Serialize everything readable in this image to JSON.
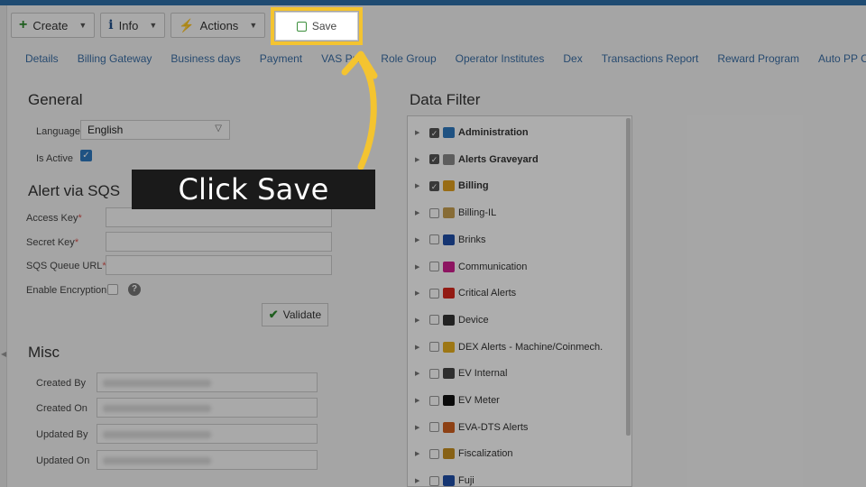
{
  "toolbar": {
    "create_label": "Create",
    "info_label": "Info",
    "actions_label": "Actions",
    "save_label": "Save"
  },
  "tabs": [
    "Details",
    "Billing Gateway",
    "Business days",
    "Payment",
    "VAS Pro",
    "Role Group",
    "Operator Institutes",
    "Dex",
    "Transactions Report",
    "Reward Program",
    "Auto PP C"
  ],
  "general": {
    "title": "General",
    "language_label": "Language",
    "language_value": "English",
    "is_active_label": "Is Active"
  },
  "sqs": {
    "title": "Alert via SQS",
    "access_key_label": "Access Key",
    "secret_key_label": "Secret Key",
    "queue_url_label": "SQS Queue URL",
    "encryption_label": "Enable Encryption",
    "required_mark": "*",
    "validate_label": "Validate"
  },
  "misc": {
    "title": "Misc",
    "created_by_label": "Created By",
    "created_on_label": "Created On",
    "updated_by_label": "Updated By",
    "updated_on_label": "Updated On"
  },
  "data_filter": {
    "title": "Data Filter",
    "items": [
      {
        "label": "Administration",
        "checked": true,
        "bold": true,
        "icon": "key-icon",
        "color": "#2f7ac0"
      },
      {
        "label": "Alerts Graveyard",
        "checked": true,
        "bold": true,
        "icon": "gravestone-icon",
        "color": "#8a8a8a"
      },
      {
        "label": "Billing",
        "checked": true,
        "bold": true,
        "icon": "billing-icon",
        "color": "#e0a020"
      },
      {
        "label": "Billing-IL",
        "checked": false,
        "bold": false,
        "icon": "billing-il-icon",
        "color": "#c8a050"
      },
      {
        "label": "Brinks",
        "checked": false,
        "bold": false,
        "icon": "brinks-icon",
        "color": "#1f4ea8"
      },
      {
        "label": "Communication",
        "checked": false,
        "bold": false,
        "icon": "signal-icon",
        "color": "#d02090"
      },
      {
        "label": "Critical Alerts",
        "checked": false,
        "bold": false,
        "icon": "warning-icon",
        "color": "#d9281e"
      },
      {
        "label": "Device",
        "checked": false,
        "bold": false,
        "icon": "device-icon",
        "color": "#333333"
      },
      {
        "label": "DEX Alerts - Machine/Coinmech.",
        "checked": false,
        "bold": false,
        "icon": "dex-icon",
        "color": "#e8b020"
      },
      {
        "label": "EV Internal",
        "checked": false,
        "bold": false,
        "icon": "ev-internal-icon",
        "color": "#444444"
      },
      {
        "label": "EV Meter",
        "checked": false,
        "bold": false,
        "icon": "ev-meter-icon",
        "color": "#111111"
      },
      {
        "label": "EVA-DTS Alerts",
        "checked": false,
        "bold": false,
        "icon": "eva-dts-icon",
        "color": "#d06020"
      },
      {
        "label": "Fiscalization",
        "checked": false,
        "bold": false,
        "icon": "fiscal-icon",
        "color": "#c89020"
      },
      {
        "label": "Fuji",
        "checked": false,
        "bold": false,
        "icon": "fuji-icon",
        "color": "#1f4ea8"
      }
    ]
  },
  "callout": {
    "text": "Click Save",
    "highlight_color": "#f4c430"
  }
}
